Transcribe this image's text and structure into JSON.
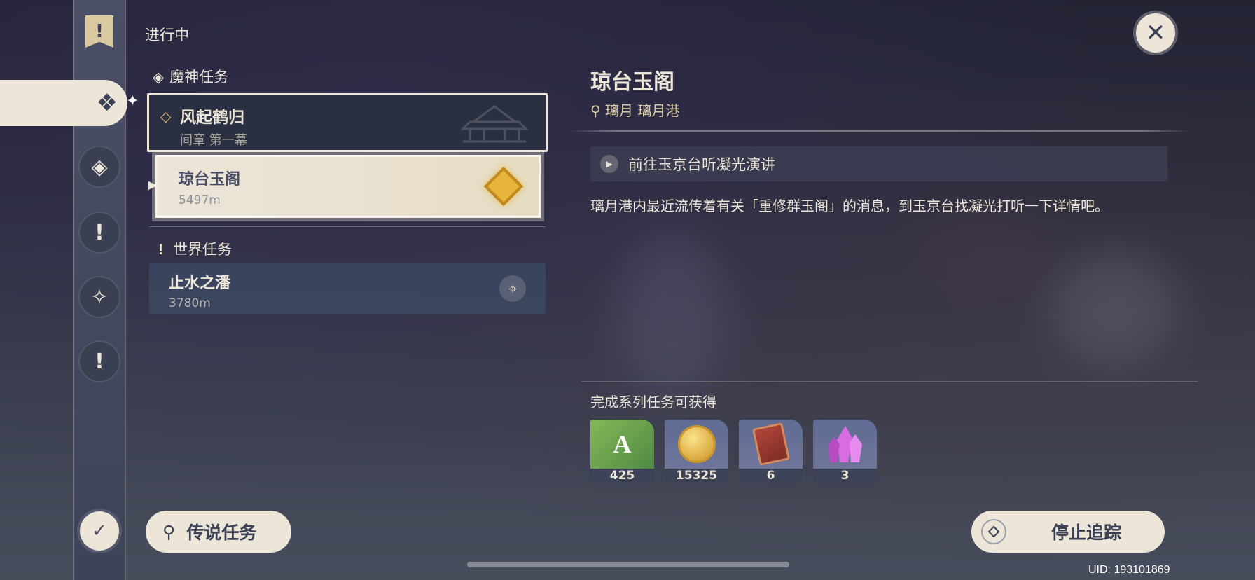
{
  "header": {
    "status_label": "进行中"
  },
  "nav": {
    "items": [
      {
        "icon": "banner-exclamation-icon"
      },
      {
        "icon": "archon-quest-icon",
        "selected": true
      },
      {
        "icon": "story-quest-icon"
      },
      {
        "icon": "world-quest-icon"
      },
      {
        "icon": "event-quest-icon"
      },
      {
        "icon": "commission-icon"
      }
    ],
    "bottom_icon": "quest-settings-icon"
  },
  "sections": {
    "archon": {
      "label": "魔神任务"
    },
    "world": {
      "label": "世界任务"
    }
  },
  "archon_quest": {
    "title": "风起鹤归",
    "chapter": "间章 第一幕",
    "subquest": {
      "title": "琼台玉阁",
      "distance": "5497m"
    }
  },
  "world_quest": {
    "title": "止水之潘",
    "distance": "3780m"
  },
  "legend_button": {
    "label": "传说任务"
  },
  "detail": {
    "title": "琼台玉阁",
    "location": "璃月 璃月港",
    "objective": "前往玉京台听凝光演讲",
    "description": "璃月港内最近流传着有关「重修群玉阁」的消息，到玉京台找凝光打听一下详情吧。",
    "rewards_label": "完成系列任务可获得",
    "rewards": [
      {
        "icon": "adventure-exp-icon",
        "count": "425"
      },
      {
        "icon": "mora-coin-icon",
        "count": "15325"
      },
      {
        "icon": "talent-book-icon",
        "count": "6"
      },
      {
        "icon": "crystal-ore-icon",
        "count": "3"
      }
    ]
  },
  "stop_button": {
    "label": "停止追踪"
  },
  "uid": "UID: 193101869",
  "colors": {
    "accent": "#ece5d8",
    "panel": "#2a3042",
    "gold": "#e7b53b"
  }
}
